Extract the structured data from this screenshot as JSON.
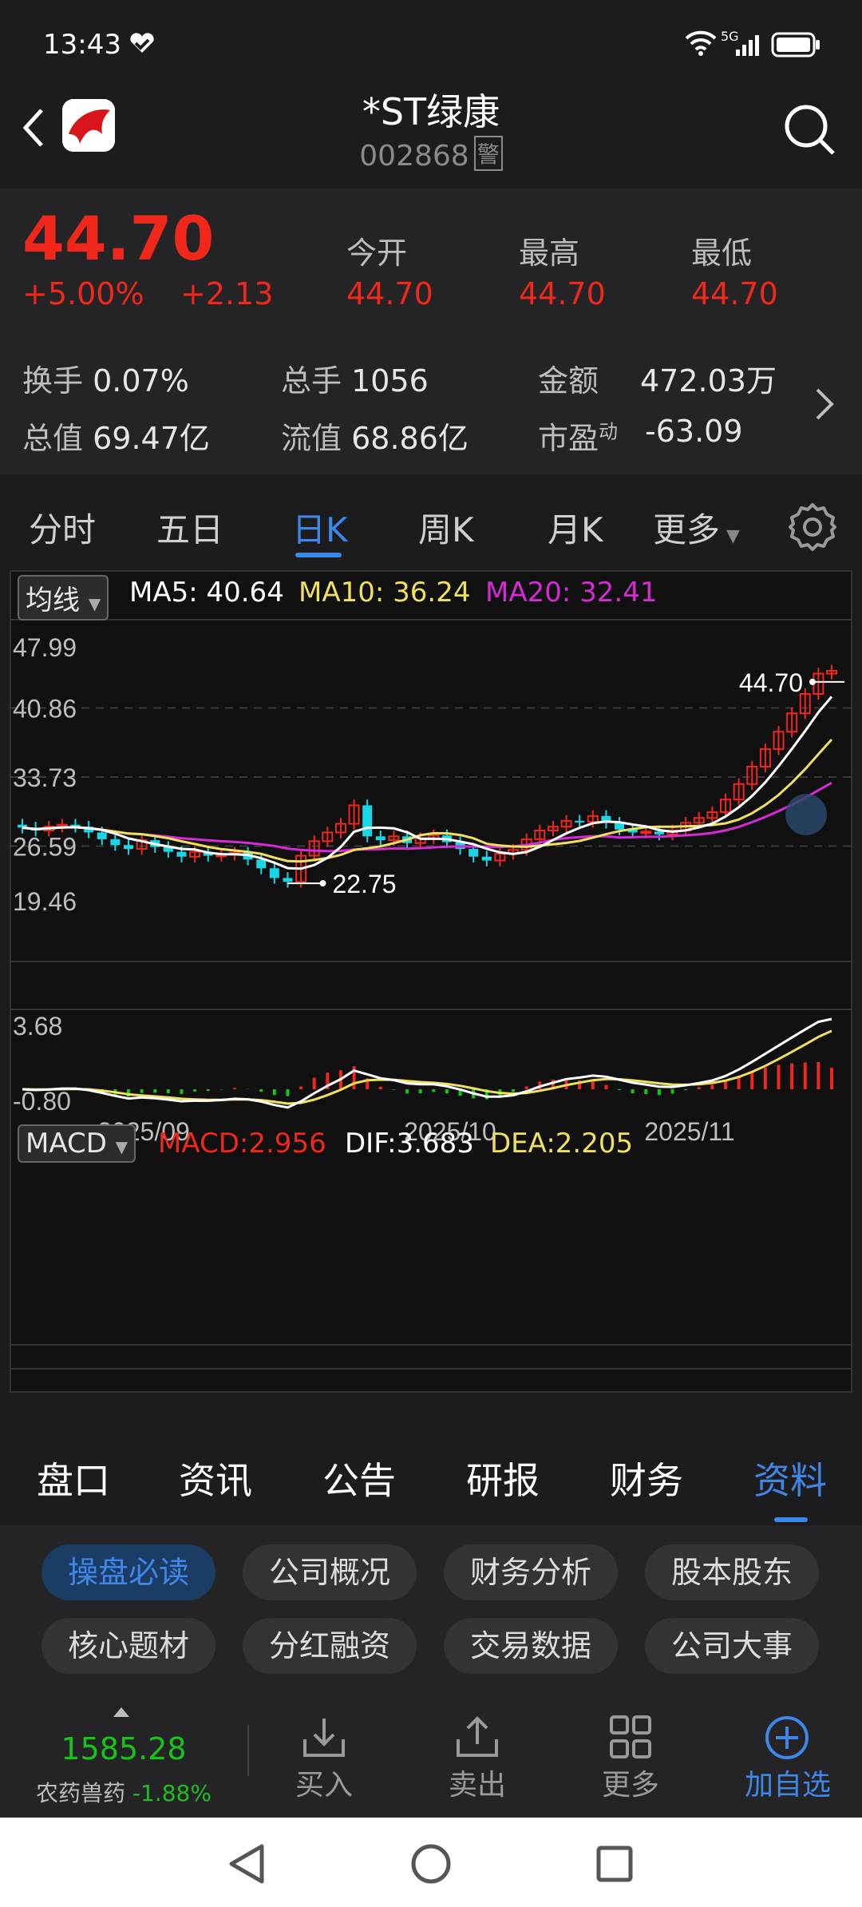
{
  "status_bar": {
    "time": "13:43",
    "network": "5G"
  },
  "header": {
    "title": "*ST绿康",
    "code": "002868",
    "warning_badge": "警"
  },
  "quote": {
    "price": "44.70",
    "change_pct": "+5.00%",
    "change": "+2.13",
    "open_label": "今开",
    "open": "44.70",
    "high_label": "最高",
    "high": "44.70",
    "low_label": "最低",
    "low": "44.70",
    "turnover_label": "换手",
    "turnover": "0.07%",
    "volume_label": "总手",
    "volume": "1056",
    "amount_label": "金额",
    "amount": "472.03万",
    "mktcap_label": "总值",
    "mktcap": "69.47亿",
    "float_label": "流值",
    "float": "68.86亿",
    "pe_label": "市盈",
    "pe_sup": "动",
    "pe": "-63.09"
  },
  "chart_tabs": [
    {
      "label": "分时"
    },
    {
      "label": "五日"
    },
    {
      "label": "日K",
      "active": true
    },
    {
      "label": "周K"
    },
    {
      "label": "月K"
    },
    {
      "label": "更多"
    }
  ],
  "chart_data": {
    "type": "candlestick",
    "ma_selector": "均线",
    "ma5_label": "MA5: 40.64",
    "ma10_label": "MA10: 36.24",
    "ma20_label": "MA20: 32.41",
    "y_ticks": [
      "47.99",
      "40.86",
      "33.73",
      "26.59",
      "19.46"
    ],
    "ylim": [
      19.46,
      47.99
    ],
    "max_marker": "44.70",
    "min_marker": "22.75",
    "close": [
      28.5,
      28.2,
      28.6,
      28.8,
      28.6,
      28.0,
      27.3,
      26.7,
      26.3,
      27.2,
      26.5,
      26.0,
      25.5,
      26.0,
      25.6,
      25.7,
      25.9,
      25.2,
      24.3,
      23.3,
      22.9,
      25.6,
      27.1,
      28.0,
      28.9,
      30.8,
      27.6,
      27.2,
      27.6,
      26.9,
      27.4,
      27.7,
      27.0,
      26.3,
      25.5,
      25.1,
      25.8,
      26.2,
      27.3,
      28.2,
      28.6,
      29.2,
      29.1,
      29.7,
      29.0,
      28.3,
      28.0,
      28.1,
      27.8,
      28.2,
      29.0,
      29.5,
      30.1,
      31.4,
      33.0,
      34.8,
      36.6,
      38.4,
      40.3,
      42.3,
      44.4,
      44.7
    ],
    "macd_selector": "MACD",
    "macd_label": "MACD:2.956",
    "dif_label": "DIF:3.683",
    "dea_label": "DEA:2.205",
    "macd_ticks": [
      "3.68",
      "-0.80"
    ],
    "x_labels": [
      "2025/09",
      "2025/10",
      "2025/11"
    ],
    "colors": {
      "up": "#f0271b",
      "down": "#19d6e6",
      "ma5": "#ffffff",
      "ma10": "#f0e060",
      "ma20": "#d42bd4",
      "macd_up": "#f0271b",
      "macd_down": "#19c219"
    }
  },
  "info_tabs": [
    {
      "label": "盘口"
    },
    {
      "label": "资讯"
    },
    {
      "label": "公告"
    },
    {
      "label": "研报"
    },
    {
      "label": "财务"
    },
    {
      "label": "资料",
      "active": true
    }
  ],
  "chips": [
    {
      "label": "操盘必读",
      "active": true
    },
    {
      "label": "公司概况"
    },
    {
      "label": "财务分析"
    },
    {
      "label": "股本股东"
    },
    {
      "label": "核心题材"
    },
    {
      "label": "分红融资"
    },
    {
      "label": "交易数据"
    },
    {
      "label": "公司大事"
    }
  ],
  "bottom": {
    "index_value": "1585.28",
    "index_name": "农药兽药",
    "index_change": "-1.88%",
    "buy": "买入",
    "sell": "卖出",
    "more": "更多",
    "add": "加自选"
  }
}
